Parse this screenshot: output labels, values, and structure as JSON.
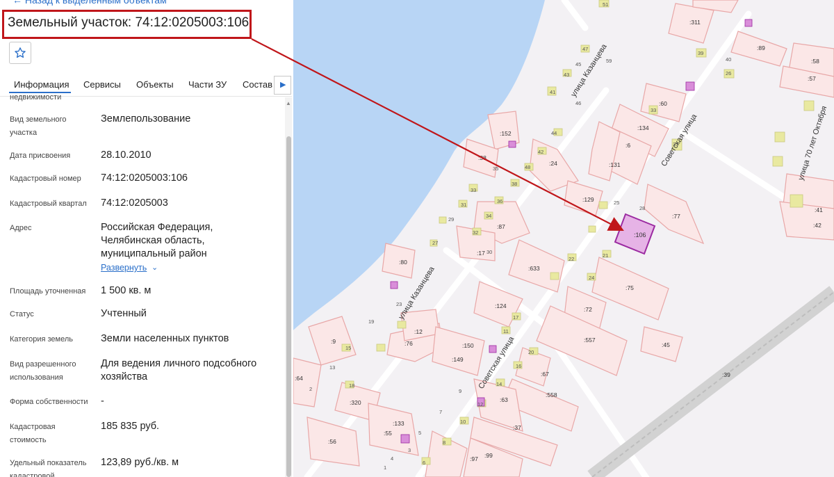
{
  "panel": {
    "back_link": "Назад к выделенным объектам",
    "title": "Земельный участок: 74:12:0205003:106",
    "tabs": [
      "Информация",
      "Сервисы",
      "Объекты",
      "Части ЗУ",
      "Состав"
    ],
    "truncated_label": "недвижимости",
    "fields": {
      "land_use_label": "Вид земельного участка",
      "land_use_value": "Землепользование",
      "assigned_label": "Дата присвоения",
      "assigned_value": "28.10.2010",
      "cadastral_label": "Кадастровый номер",
      "cadastral_value": "74:12:0205003:106",
      "quarter_label": "Кадастровый квартал",
      "quarter_value": "74:12:0205003",
      "address_label": "Адрес",
      "address_value": "Российская Федерация, Челябинская область, муниципальный район",
      "expand_label": "Развернуть",
      "area_label": "Площадь уточненная",
      "area_value": "1 500 кв. м",
      "status_label": "Статус",
      "status_value": "Учтенный",
      "category_label": "Категория земель",
      "category_value": "Земли населенных пунктов",
      "permitted_label": "Вид разрешенного использования",
      "permitted_value": "Для ведения личного подсобного хозяйства",
      "ownership_label": "Форма собственности",
      "ownership_value": "-",
      "cost_label": "Кадастровая стоимость",
      "cost_value": "185 835 руб.",
      "specific_label": "Удельный показатель кадастровой",
      "specific_value": "123,89 руб./кв. м"
    }
  },
  "map": {
    "streets": {
      "kazantseva_1": "улица Казанцева",
      "kazantseva_2": "улица Казанцева",
      "sovetskaya_1": "Советская улица",
      "sovetskaya_2": "Советская улица",
      "oktyabrya": "улица 70 лет Октября"
    },
    "highlighted_parcel": ":106",
    "parcels": [
      ":311",
      ":152",
      ":38",
      ":24",
      ":134",
      ":6",
      ":131",
      ":60",
      ":89",
      ":58",
      ":57",
      ":129",
      ":77",
      ":41",
      ":42",
      ":87",
      ":17",
      ":633",
      ":80",
      ":124",
      ":72",
      ":75",
      ":557",
      ":45",
      ":9",
      ":76",
      ":12",
      ":150",
      ":149",
      ":67",
      ":558",
      ":64",
      ":320",
      ":133",
      ":55",
      ":63",
      ":37",
      ":56",
      ":97",
      ":99",
      ":39"
    ],
    "buildings": [
      "51",
      "47",
      "45",
      "43",
      "41",
      "46",
      "59",
      "44",
      "42",
      "48",
      "35",
      "38",
      "33",
      "31",
      "36",
      "34",
      "32",
      "30",
      "29",
      "27",
      "25",
      "28",
      "23",
      "21",
      "24",
      "22",
      "19",
      "20",
      "18",
      "16",
      "14",
      "12",
      "10",
      "8",
      "6",
      "4",
      "2",
      "13",
      "15",
      "17",
      "11",
      "9",
      "7",
      "5",
      "3",
      "1",
      "33",
      "39",
      "37",
      "26",
      "40"
    ],
    "colors": {
      "water": "#b8d5f5",
      "parcel_fill": "#fbe7e7",
      "parcel_stroke": "#e8a7a7",
      "highlight_fill": "#e6b3e6",
      "highlight_stroke": "#9b2aa1",
      "building": "#e9e9a0",
      "arrow": "#c0161a"
    }
  }
}
